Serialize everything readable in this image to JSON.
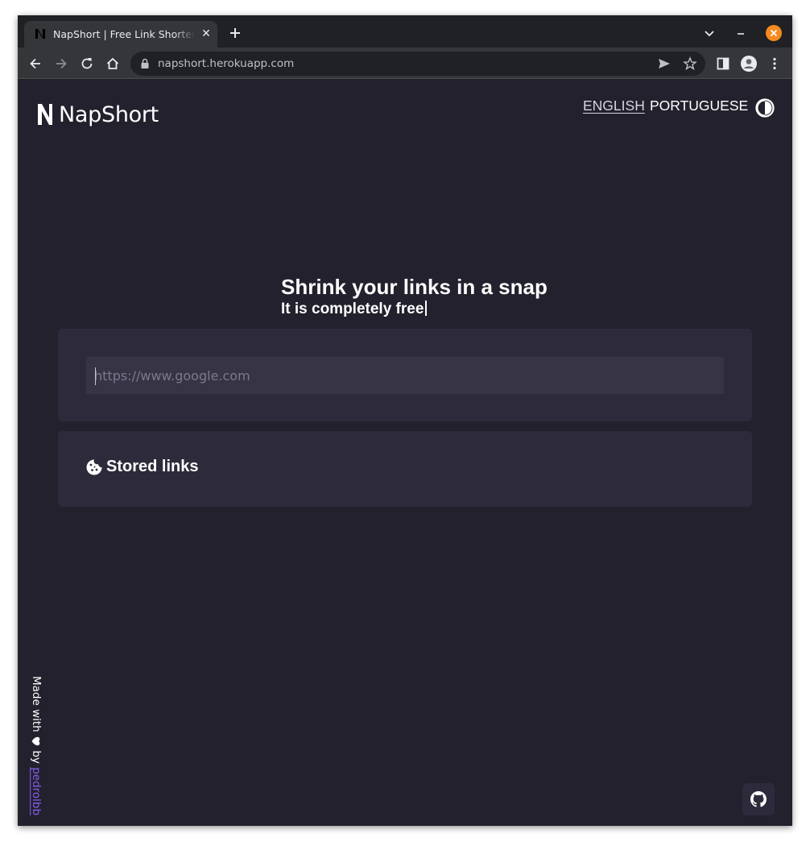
{
  "browser": {
    "tab_title": "NapShort | Free Link Shortener",
    "url": "napshort.herokuapp.com",
    "icons": [
      "back-icon",
      "forward-icon",
      "reload-icon",
      "home-icon",
      "lock-icon",
      "send-icon",
      "star-icon",
      "sidepanel-icon",
      "profile-icon",
      "menu-icon"
    ],
    "close_button_color": "#f68a1e"
  },
  "header": {
    "brand": "NapShort",
    "languages": [
      {
        "label": "ENGLISH",
        "active": true
      },
      {
        "label": "PORTUGUESE",
        "active": false
      }
    ],
    "theme_icon": "contrast-icon"
  },
  "hero": {
    "title": "Shrink your links in a snap",
    "subtitle": "It is completely free"
  },
  "shortener": {
    "placeholder": "https://www.google.com",
    "value": ""
  },
  "stored_links": {
    "title": "Stored links",
    "icon": "cookie-icon"
  },
  "footer": {
    "made_with": "Made with",
    "by": "by",
    "author": "pedrolbb",
    "author_color": "#8b5cf6",
    "github_icon": "github-icon"
  },
  "colors": {
    "page_background": "#22212d",
    "card_background": "#2d2b3b",
    "input_background": "#373545"
  }
}
